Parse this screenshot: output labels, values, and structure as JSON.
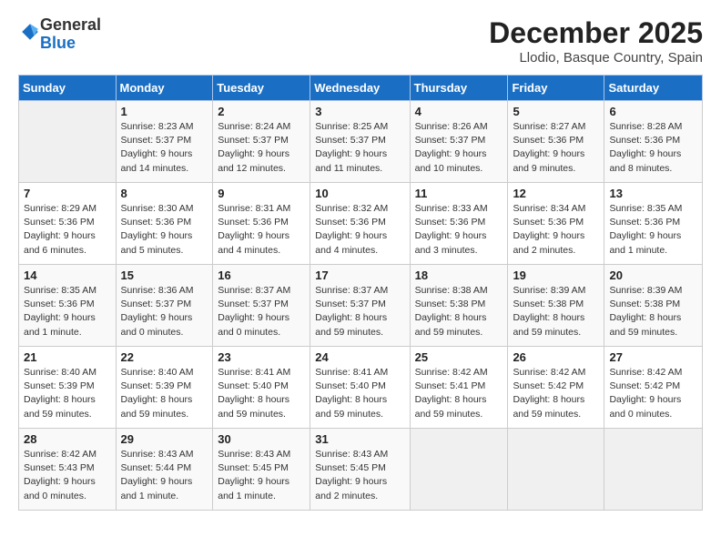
{
  "logo": {
    "general": "General",
    "blue": "Blue"
  },
  "header": {
    "month": "December 2025",
    "location": "Llodio, Basque Country, Spain"
  },
  "weekdays": [
    "Sunday",
    "Monday",
    "Tuesday",
    "Wednesday",
    "Thursday",
    "Friday",
    "Saturday"
  ],
  "weeks": [
    [
      {
        "day": "",
        "info": ""
      },
      {
        "day": "1",
        "info": "Sunrise: 8:23 AM\nSunset: 5:37 PM\nDaylight: 9 hours\nand 14 minutes."
      },
      {
        "day": "2",
        "info": "Sunrise: 8:24 AM\nSunset: 5:37 PM\nDaylight: 9 hours\nand 12 minutes."
      },
      {
        "day": "3",
        "info": "Sunrise: 8:25 AM\nSunset: 5:37 PM\nDaylight: 9 hours\nand 11 minutes."
      },
      {
        "day": "4",
        "info": "Sunrise: 8:26 AM\nSunset: 5:37 PM\nDaylight: 9 hours\nand 10 minutes."
      },
      {
        "day": "5",
        "info": "Sunrise: 8:27 AM\nSunset: 5:36 PM\nDaylight: 9 hours\nand 9 minutes."
      },
      {
        "day": "6",
        "info": "Sunrise: 8:28 AM\nSunset: 5:36 PM\nDaylight: 9 hours\nand 8 minutes."
      }
    ],
    [
      {
        "day": "7",
        "info": "Sunrise: 8:29 AM\nSunset: 5:36 PM\nDaylight: 9 hours\nand 6 minutes."
      },
      {
        "day": "8",
        "info": "Sunrise: 8:30 AM\nSunset: 5:36 PM\nDaylight: 9 hours\nand 5 minutes."
      },
      {
        "day": "9",
        "info": "Sunrise: 8:31 AM\nSunset: 5:36 PM\nDaylight: 9 hours\nand 4 minutes."
      },
      {
        "day": "10",
        "info": "Sunrise: 8:32 AM\nSunset: 5:36 PM\nDaylight: 9 hours\nand 4 minutes."
      },
      {
        "day": "11",
        "info": "Sunrise: 8:33 AM\nSunset: 5:36 PM\nDaylight: 9 hours\nand 3 minutes."
      },
      {
        "day": "12",
        "info": "Sunrise: 8:34 AM\nSunset: 5:36 PM\nDaylight: 9 hours\nand 2 minutes."
      },
      {
        "day": "13",
        "info": "Sunrise: 8:35 AM\nSunset: 5:36 PM\nDaylight: 9 hours\nand 1 minute."
      }
    ],
    [
      {
        "day": "14",
        "info": "Sunrise: 8:35 AM\nSunset: 5:36 PM\nDaylight: 9 hours\nand 1 minute."
      },
      {
        "day": "15",
        "info": "Sunrise: 8:36 AM\nSunset: 5:37 PM\nDaylight: 9 hours\nand 0 minutes."
      },
      {
        "day": "16",
        "info": "Sunrise: 8:37 AM\nSunset: 5:37 PM\nDaylight: 9 hours\nand 0 minutes."
      },
      {
        "day": "17",
        "info": "Sunrise: 8:37 AM\nSunset: 5:37 PM\nDaylight: 8 hours\nand 59 minutes."
      },
      {
        "day": "18",
        "info": "Sunrise: 8:38 AM\nSunset: 5:38 PM\nDaylight: 8 hours\nand 59 minutes."
      },
      {
        "day": "19",
        "info": "Sunrise: 8:39 AM\nSunset: 5:38 PM\nDaylight: 8 hours\nand 59 minutes."
      },
      {
        "day": "20",
        "info": "Sunrise: 8:39 AM\nSunset: 5:38 PM\nDaylight: 8 hours\nand 59 minutes."
      }
    ],
    [
      {
        "day": "21",
        "info": "Sunrise: 8:40 AM\nSunset: 5:39 PM\nDaylight: 8 hours\nand 59 minutes."
      },
      {
        "day": "22",
        "info": "Sunrise: 8:40 AM\nSunset: 5:39 PM\nDaylight: 8 hours\nand 59 minutes."
      },
      {
        "day": "23",
        "info": "Sunrise: 8:41 AM\nSunset: 5:40 PM\nDaylight: 8 hours\nand 59 minutes."
      },
      {
        "day": "24",
        "info": "Sunrise: 8:41 AM\nSunset: 5:40 PM\nDaylight: 8 hours\nand 59 minutes."
      },
      {
        "day": "25",
        "info": "Sunrise: 8:42 AM\nSunset: 5:41 PM\nDaylight: 8 hours\nand 59 minutes."
      },
      {
        "day": "26",
        "info": "Sunrise: 8:42 AM\nSunset: 5:42 PM\nDaylight: 8 hours\nand 59 minutes."
      },
      {
        "day": "27",
        "info": "Sunrise: 8:42 AM\nSunset: 5:42 PM\nDaylight: 9 hours\nand 0 minutes."
      }
    ],
    [
      {
        "day": "28",
        "info": "Sunrise: 8:42 AM\nSunset: 5:43 PM\nDaylight: 9 hours\nand 0 minutes."
      },
      {
        "day": "29",
        "info": "Sunrise: 8:43 AM\nSunset: 5:44 PM\nDaylight: 9 hours\nand 1 minute."
      },
      {
        "day": "30",
        "info": "Sunrise: 8:43 AM\nSunset: 5:45 PM\nDaylight: 9 hours\nand 1 minute."
      },
      {
        "day": "31",
        "info": "Sunrise: 8:43 AM\nSunset: 5:45 PM\nDaylight: 9 hours\nand 2 minutes."
      },
      {
        "day": "",
        "info": ""
      },
      {
        "day": "",
        "info": ""
      },
      {
        "day": "",
        "info": ""
      }
    ]
  ]
}
